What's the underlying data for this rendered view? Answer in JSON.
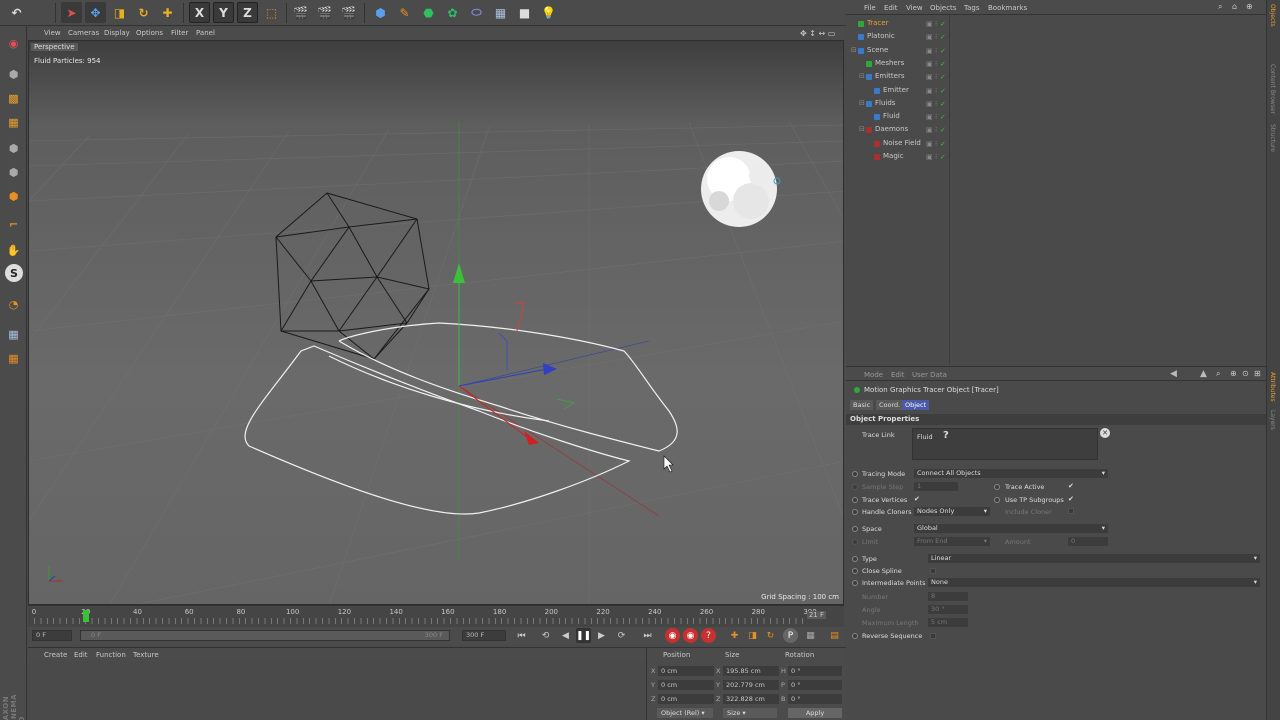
{
  "viewport": {
    "menu": [
      "View",
      "Cameras",
      "Display",
      "Options",
      "Filter",
      "Panel"
    ],
    "label": "Perspective",
    "fluid_particles": "Fluid Particles: 954",
    "grid_spacing": "Grid Spacing : 100 cm"
  },
  "brand": "MAXON CINEMA 4D",
  "timeline": {
    "ticks": [
      "0",
      "20",
      "40",
      "60",
      "80",
      "100",
      "120",
      "140",
      "160",
      "180",
      "200",
      "220",
      "240",
      "260",
      "280",
      "300"
    ],
    "current_frame": 20,
    "end_frame": "21 F"
  },
  "transport": {
    "start_field": "0 F",
    "range_left": "0 F",
    "range_right": "300 F",
    "end_field": "300 F"
  },
  "material_menu": [
    "Create",
    "Edit",
    "Function",
    "Texture"
  ],
  "coords": {
    "headers": {
      "position": "Position",
      "size": "Size",
      "rotation": "Rotation"
    },
    "rows": [
      {
        "axis": "X",
        "pos": "0 cm",
        "size_axis": "X",
        "size": "195.85 cm",
        "rot_axis": "H",
        "rot": "0 °"
      },
      {
        "axis": "Y",
        "pos": "0 cm",
        "size_axis": "Y",
        "size": "202.779 cm",
        "rot_axis": "P",
        "rot": "0 °"
      },
      {
        "axis": "Z",
        "pos": "0 cm",
        "size_axis": "Z",
        "size": "322.828 cm",
        "rot_axis": "B",
        "rot": "0 °"
      }
    ],
    "mode_dropdown": "Object (Rel)",
    "size_dropdown": "Size",
    "apply": "Apply"
  },
  "object_manager": {
    "menu": [
      "File",
      "Edit",
      "View",
      "Objects",
      "Tags",
      "Bookmarks"
    ],
    "objects": [
      {
        "name": "Tracer",
        "indent": 0,
        "color": "#2fa83a",
        "selected": true
      },
      {
        "name": "Platonic",
        "indent": 0,
        "color": "#3a7ac8",
        "selected": false
      },
      {
        "name": "Scene",
        "indent": 0,
        "color": "#3a7ac8",
        "selected": false
      },
      {
        "name": "Meshers",
        "indent": 1,
        "color": "#2fa83a",
        "selected": false
      },
      {
        "name": "Emitters",
        "indent": 1,
        "color": "#3a7ac8",
        "selected": false
      },
      {
        "name": "Emitter",
        "indent": 2,
        "color": "#3a7ac8",
        "selected": false
      },
      {
        "name": "Fluids",
        "indent": 1,
        "color": "#3a7ac8",
        "selected": false
      },
      {
        "name": "Fluid",
        "indent": 2,
        "color": "#3a7ac8",
        "selected": false
      },
      {
        "name": "Daemons",
        "indent": 1,
        "color": "#a83030",
        "selected": false
      },
      {
        "name": "Noise Field",
        "indent": 2,
        "color": "#a83030",
        "selected": false
      },
      {
        "name": "Magic",
        "indent": 2,
        "color": "#a83030",
        "selected": false
      }
    ]
  },
  "attributes": {
    "menu": [
      "Mode",
      "Edit",
      "User Data"
    ],
    "title": "Motion Graphics Tracer Object [Tracer]",
    "tabs": [
      "Basic",
      "Coord.",
      "Object"
    ],
    "active_tab": "Object",
    "section": "Object Properties",
    "trace_link_label": "Trace Link",
    "trace_link_value": "Fluid",
    "tracing_mode_label": "Tracing Mode",
    "tracing_mode_value": "Connect All Objects",
    "sample_step_label": "Sample Step",
    "sample_step_value": "1",
    "trace_active_label": "Trace Active",
    "trace_vertices_label": "Trace Vertices",
    "use_tp_subgroups_label": "Use TP Subgroups",
    "handle_cloners_label": "Handle Cloners",
    "handle_cloners_value": "Nodes Only",
    "include_cloner_label": "Include Cloner",
    "space_label": "Space",
    "space_value": "Global",
    "limit_label": "Limit",
    "limit_value": "From End",
    "amount_label": "Amount",
    "amount_value": "0",
    "type_label": "Type",
    "type_value": "Linear",
    "close_spline_label": "Close Spline",
    "intermediate_points_label": "Intermediate Points",
    "intermediate_points_value": "None",
    "number_label": "Number",
    "number_value": "8",
    "angle_label": "Angle",
    "angle_value": "30 °",
    "max_length_label": "Maximum Length",
    "max_length_value": "5 cm",
    "reverse_sequence_label": "Reverse Sequence"
  },
  "right_strip_tabs": [
    "Objects",
    "Content Browser",
    "Structure",
    "Attributes",
    "Layers"
  ],
  "colors": {
    "accent": "#4a5aa8",
    "selected_text": "#e8a030",
    "transport_red": "#c83030",
    "transport_orange": "#e89020"
  }
}
